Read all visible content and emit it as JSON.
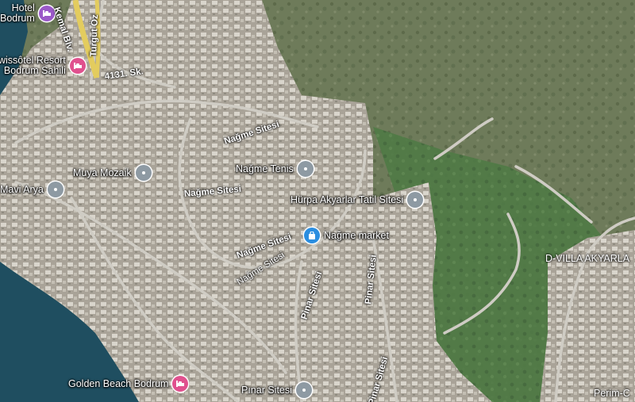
{
  "map": {
    "view": "satellite",
    "pois": [
      {
        "id": "hotel-bodrum",
        "label": "Hotel\nBodrum",
        "kind": "hotel-purple"
      },
      {
        "id": "swissotel",
        "label": "wissôtel Resort\nBodrum Sahili",
        "kind": "hotel"
      },
      {
        "id": "muya-mozaik",
        "label": "Muya Mozaik",
        "kind": "place"
      },
      {
        "id": "mavi-arya",
        "label": "Mavi Arya",
        "kind": "place"
      },
      {
        "id": "nagme-tenis",
        "label": "Nağme Tenis",
        "kind": "place"
      },
      {
        "id": "hurpa-akyarlar",
        "label": "Hürpa Akyarlar Tatil Sitesi",
        "kind": "place"
      },
      {
        "id": "nagme-market",
        "label": "Nağme market",
        "kind": "shop"
      },
      {
        "id": "golden-beach",
        "label": "Golden Beach Bodrum",
        "kind": "hotel"
      },
      {
        "id": "pinar-sitesi-poi",
        "label": "Pınar Sitesi",
        "kind": "place"
      }
    ],
    "streets": [
      {
        "id": "kemal-blv",
        "label": "Kemal Blv."
      },
      {
        "id": "turgut-ozal",
        "label": "Turgut Öz"
      },
      {
        "id": "sk-4131",
        "label": "4131. Sk."
      },
      {
        "id": "nagme-sitesi-1",
        "label": "Nağme Sitesi"
      },
      {
        "id": "nagme-sitesi-2",
        "label": "Nağme Sitesi"
      },
      {
        "id": "nagme-sitesi-3",
        "label": "Nağme Sitesi"
      },
      {
        "id": "nagme-sitesi-4",
        "label": "Nağme Sitesi"
      },
      {
        "id": "pinar-sitesi-1",
        "label": "Pinar Sitesi"
      },
      {
        "id": "pinar-sitesi-2",
        "label": "Pinar Sitesi"
      },
      {
        "id": "pinar-sitesi-3",
        "label": "Pinar Sitesi"
      }
    ],
    "areas": [
      {
        "id": "d-villa",
        "label": "D-VILLA AKYARLA"
      },
      {
        "id": "perim",
        "label": "Perim-C"
      }
    ],
    "colors": {
      "sea": "#1d4a5c",
      "terrain": "#6f7d5c",
      "urban": "#a8a297",
      "road": "#c9c6bf",
      "highway": "#e8d46a"
    }
  }
}
